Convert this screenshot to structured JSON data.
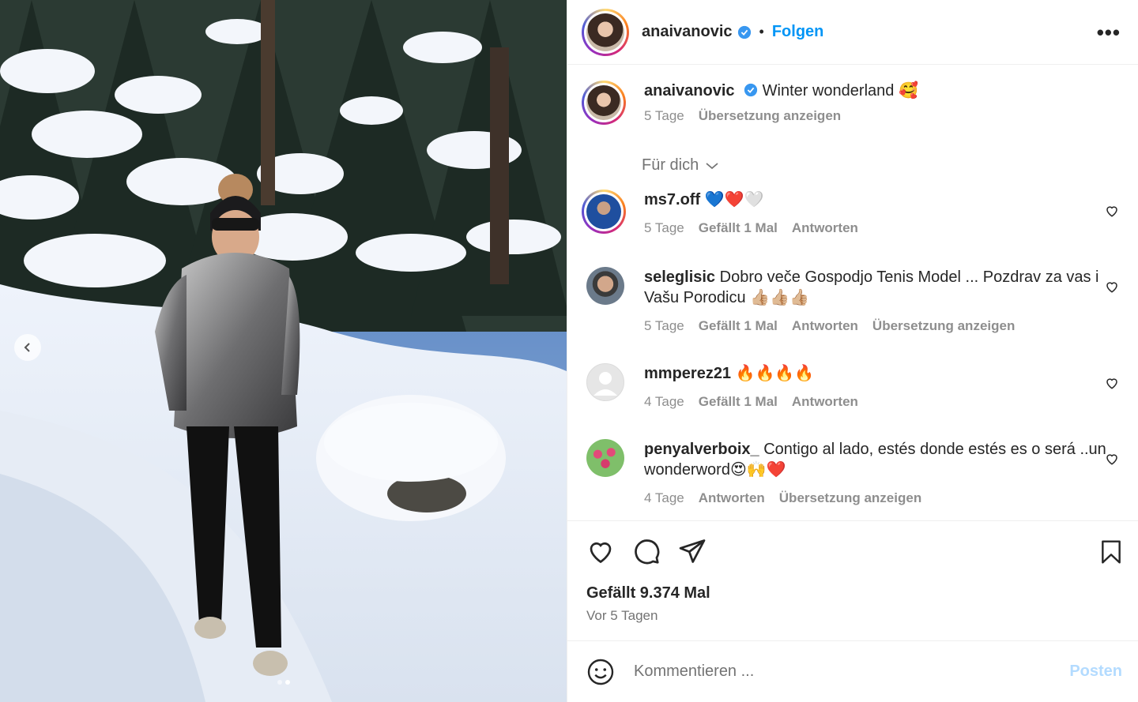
{
  "post": {
    "username": "anaivanovic",
    "follow_label": "Folgen",
    "separator": "•",
    "more_label": "•••",
    "caption": "Winter wonderland 🥰",
    "caption_time": "5 Tage",
    "caption_translate": "Übersetzung anzeigen",
    "for_you": "Für dich",
    "likes": "Gefällt 9.374 Mal",
    "posted_ago": "Vor 5 Tagen",
    "comment_placeholder": "Kommentieren ...",
    "post_label": "Posten"
  },
  "comments": [
    {
      "user": "ms7.off",
      "text": "💙❤️🤍",
      "time": "5 Tage",
      "likes": "Gefällt 1 Mal",
      "reply": "Antworten",
      "translate": ""
    },
    {
      "user": "seleglisic",
      "text": "Dobro veče Gospodjo Tenis Model ... Pozdrav za vas i Vašu Porodicu 👍🏼👍🏼👍🏼",
      "time": "5 Tage",
      "likes": "Gefällt 1 Mal",
      "reply": "Antworten",
      "translate": "Übersetzung anzeigen"
    },
    {
      "user": "mmperez21",
      "text": "🔥🔥🔥🔥",
      "time": "4 Tage",
      "likes": "Gefällt 1 Mal",
      "reply": "Antworten",
      "translate": ""
    },
    {
      "user": "penyalverboix_",
      "text": "Contigo al lado, estés donde estés es o será ..un wonderword😍🙌❤️",
      "time": "4 Tage",
      "likes": "",
      "reply": "Antworten",
      "translate": "Übersetzung anzeigen"
    }
  ],
  "colors": {
    "accent": "#0095f6",
    "muted": "#8e8e8e",
    "post_disabled": "#b3dbff"
  },
  "icons": [
    "chevron-left-icon",
    "verified-icon",
    "more-icon",
    "heart-icon",
    "comment-icon",
    "share-icon",
    "bookmark-icon",
    "emoji-icon",
    "chevron-down-icon"
  ]
}
